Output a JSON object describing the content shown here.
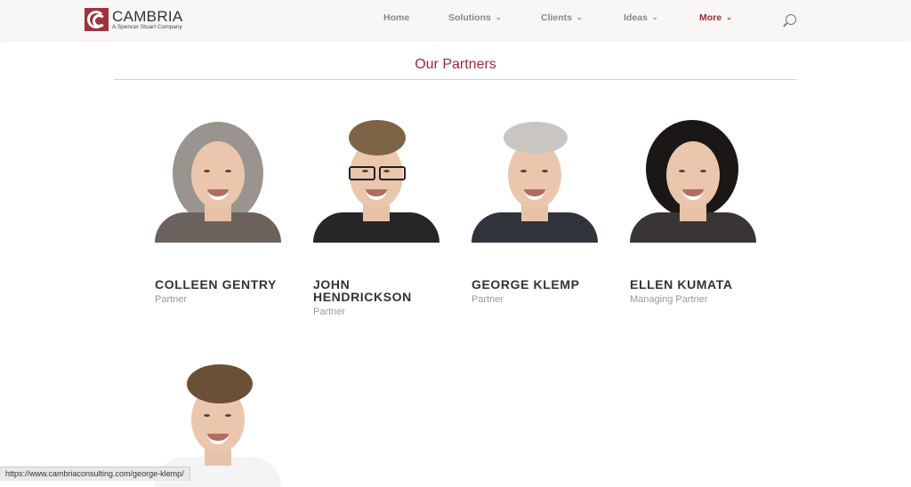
{
  "header": {
    "logo": {
      "name": "CAMBRIA",
      "tagline": "A Spencer Stuart Company"
    },
    "nav": [
      {
        "label": "Home",
        "dropdown": false,
        "active": false
      },
      {
        "label": "Solutions",
        "dropdown": true,
        "active": false
      },
      {
        "label": "Clients",
        "dropdown": true,
        "active": false
      },
      {
        "label": "Ideas",
        "dropdown": true,
        "active": false
      },
      {
        "label": "More",
        "dropdown": true,
        "active": true
      }
    ],
    "search_icon": "search-icon"
  },
  "main": {
    "section_title": "Our Partners",
    "partners": [
      {
        "name": "COLLEEN GENTRY",
        "role": "Partner"
      },
      {
        "name": "JOHN HENDRICKSON",
        "role": "Partner"
      },
      {
        "name": "GEORGE KLEMP",
        "role": "Partner"
      },
      {
        "name": "ELLEN KUMATA",
        "role": "Managing Partner"
      }
    ]
  },
  "status_bar": {
    "url": "https://www.cambriaconsulting.com/george-klemp/"
  },
  "colors": {
    "accent": "#9b2a38",
    "logo": "#a0313f",
    "header_bg": "#f9f6f6",
    "muted_text": "#999999"
  }
}
